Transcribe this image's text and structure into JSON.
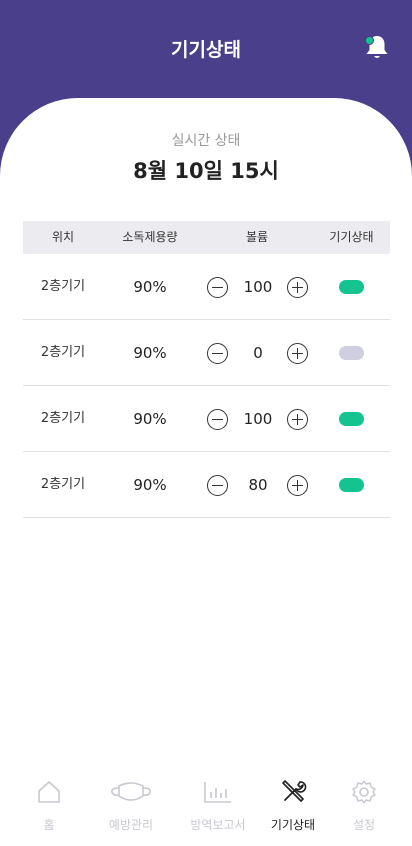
{
  "header": {
    "title": "기기상태",
    "bell_icon": "bell-icon",
    "accent": "#4a3f8a",
    "badge_color": "#13c491"
  },
  "status": {
    "subtitle": "실시간 상태",
    "datetime": "8월 10일 15시"
  },
  "table": {
    "headers": [
      "위치",
      "소독제용량",
      "볼륨",
      "기기상태"
    ],
    "rows": [
      {
        "location": "2층기기",
        "usage": "90%",
        "volume": "100",
        "on": true
      },
      {
        "location": "2층기기",
        "usage": "90%",
        "volume": "0",
        "on": false
      },
      {
        "location": "2층기기",
        "usage": "90%",
        "volume": "100",
        "on": true
      },
      {
        "location": "2층기기",
        "usage": "90%",
        "volume": "80",
        "on": true
      }
    ],
    "toggle_on_color": "#13c491",
    "toggle_off_color": "#cfcfe0"
  },
  "nav": {
    "items": [
      {
        "label": "홈",
        "icon": "home-icon",
        "active": false
      },
      {
        "label": "예방관리",
        "icon": "mask-icon",
        "active": false
      },
      {
        "label": "방역보고서",
        "icon": "bar-chart-icon",
        "active": false
      },
      {
        "label": "기기상태",
        "icon": "tools-icon",
        "active": true
      },
      {
        "label": "설정",
        "icon": "gear-icon",
        "active": false
      }
    ]
  }
}
